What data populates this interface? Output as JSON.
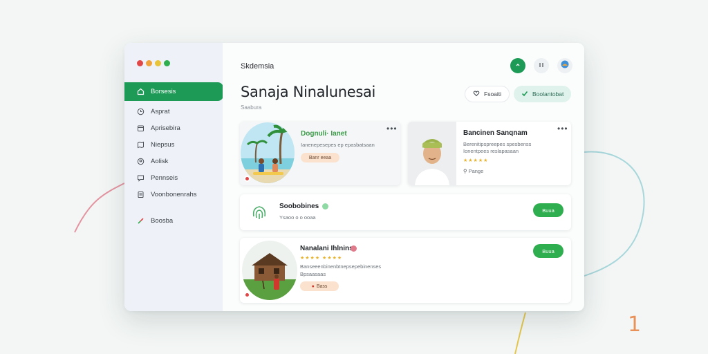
{
  "sidebar": {
    "traffic_colors": [
      "#e04848",
      "#f0a33a",
      "#e8c43a",
      "#2fae4f"
    ],
    "items": [
      {
        "label": "Borsesis",
        "icon": "home-icon",
        "active": true
      },
      {
        "label": "Asprat",
        "icon": "clock-icon"
      },
      {
        "label": "Aprisebira",
        "icon": "calendar-icon"
      },
      {
        "label": "Niepsus",
        "icon": "map-icon"
      },
      {
        "label": "Aolisk",
        "icon": "user-icon"
      },
      {
        "label": "Pennseis",
        "icon": "chat-icon"
      },
      {
        "label": "Voonbonenrahs",
        "icon": "document-icon"
      }
    ],
    "footer": {
      "label": "Boosba",
      "icon": "brush-icon"
    }
  },
  "header": {
    "app_title": "Skdemsia",
    "icons": [
      "green-action-icon",
      "bell-icon",
      "avatar-icon"
    ]
  },
  "page": {
    "title": "Sanaja Ninalunesai",
    "subtitle": "Saabura"
  },
  "actions": {
    "secondary": {
      "label": "Fsoaiti",
      "icon": "heart-icon"
    },
    "primary": {
      "label": "Boolantobat",
      "icon": "check-icon"
    }
  },
  "cards": {
    "beach": {
      "title": "Dognuli· Ianet",
      "line": "Ianenepesepes ep epasbatsaan",
      "tag": "Banr eeaa",
      "menu": "•••"
    },
    "profile": {
      "title": "Bancinen Sanqnam",
      "line1": "Berenitipspreepes spesbenss",
      "line2": "Ionentpees reslapasaan",
      "rating": "★★★★★",
      "meta": "Pange",
      "menu": "•••"
    },
    "notice": {
      "title": "Soobobines",
      "line": "Ysaoo o o ooaa",
      "button": "Buua"
    },
    "listing": {
      "title": "Nanalani Ihlnins",
      "rating": "★★★★ ★★★★",
      "line1": "Banseeenbinenbtnepsepebinenses",
      "line2": "Bpsaasaas",
      "tag": "Bass",
      "button": "Buua"
    }
  },
  "colors": {
    "accent_green": "#1e9a57",
    "button_green": "#2fae4f",
    "title_green": "#3a9a47",
    "tag_peach": "#fbe2cf",
    "mint": "#dff3ec"
  }
}
